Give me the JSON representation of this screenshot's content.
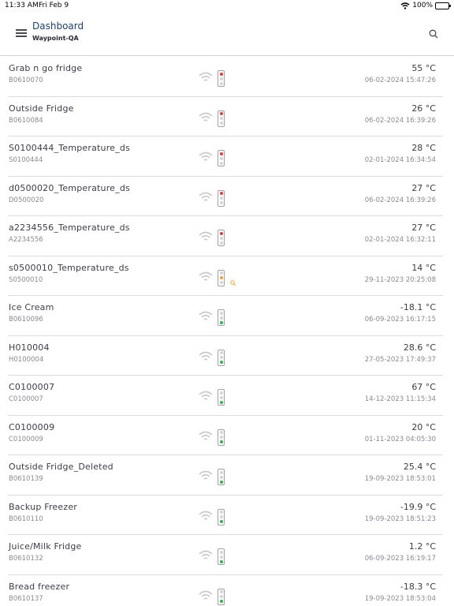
{
  "status_bar": {
    "time": "11:33 AM",
    "date": "Fri Feb 9",
    "battery": "100%"
  },
  "header": {
    "title": "Dashboard",
    "subtitle": "Waypoint-QA"
  },
  "colors": {
    "red": "#e23b3b",
    "orange": "#f0a030",
    "green": "#2db34a",
    "off": "#d4d4d8",
    "title": "#1f3f6e"
  },
  "devices": [
    {
      "name": "Grab n go fridge",
      "id": "B0610070",
      "temp": "55 °C",
      "time": "06-02-2024 15:47:26",
      "status": "red",
      "warning": false
    },
    {
      "name": "Outside Fridge",
      "id": "B0610084",
      "temp": "26 °C",
      "time": "06-02-2024 16:39:26",
      "status": "red",
      "warning": false
    },
    {
      "name": "S0100444_Temperature_ds",
      "id": "S0100444",
      "temp": "28 °C",
      "time": "02-01-2024 16:34:54",
      "status": "red",
      "warning": false
    },
    {
      "name": "d0500020_Temperature_ds",
      "id": "D0500020",
      "temp": "27 °C",
      "time": "06-02-2024 16:39:26",
      "status": "red",
      "warning": false
    },
    {
      "name": "a2234556_Temperature_ds",
      "id": "A2234556",
      "temp": "27 °C",
      "time": "02-01-2024 16:32:11",
      "status": "red",
      "warning": false
    },
    {
      "name": "s0500010_Temperature_ds",
      "id": "S0500010",
      "temp": "14 °C",
      "time": "29-11-2023 20:25:08",
      "status": "orange",
      "warning": true
    },
    {
      "name": "Ice Cream",
      "id": "B0610096",
      "temp": "-18.1 °C",
      "time": "06-09-2023 16:17:15",
      "status": "green",
      "warning": false
    },
    {
      "name": "H010004",
      "id": "H0100004",
      "temp": "28.6 °C",
      "time": "27-05-2023 17:49:37",
      "status": "green",
      "warning": false
    },
    {
      "name": "C0100007",
      "id": "C0100007",
      "temp": "67 °C",
      "time": "14-12-2023 11:15:34",
      "status": "green",
      "warning": false
    },
    {
      "name": "C0100009",
      "id": "C0100009",
      "temp": "20 °C",
      "time": "01-11-2023 04:05:30",
      "status": "green",
      "warning": false
    },
    {
      "name": "Outside Fridge_Deleted",
      "id": "B0610139",
      "temp": "25.4 °C",
      "time": "19-09-2023 18:53:01",
      "status": "green",
      "warning": false
    },
    {
      "name": "Backup Freezer",
      "id": "B0610110",
      "temp": "-19.9 °C",
      "time": "19-09-2023 18:51:23",
      "status": "green",
      "warning": false
    },
    {
      "name": "Juice/Milk Fridge",
      "id": "B0610132",
      "temp": "1.2 °C",
      "time": "06-09-2023 16:19:17",
      "status": "green",
      "warning": false
    },
    {
      "name": "Bread freezer",
      "id": "B0610137",
      "temp": "-18.3 °C",
      "time": "19-09-2023 18:53:04",
      "status": "green",
      "warning": false
    }
  ]
}
